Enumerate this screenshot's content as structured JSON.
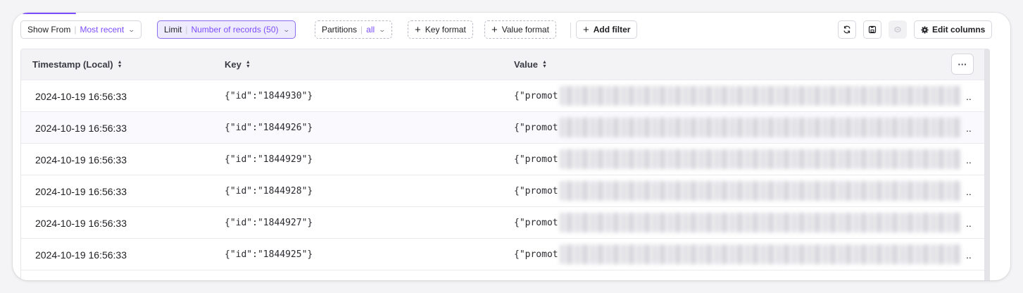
{
  "toolbar": {
    "show_from": {
      "label": "Show From",
      "value": "Most recent"
    },
    "limit": {
      "label": "Limit",
      "value": "Number of records (50)"
    },
    "partitions": {
      "label": "Partitions",
      "value": "all"
    },
    "key_format": "Key format",
    "value_format": "Value format",
    "add_filter": "Add filter",
    "edit_columns": "Edit columns",
    "accent_color": "#7c4dff"
  },
  "table": {
    "columns": [
      "Timestamp (Local)",
      "Key",
      "Value"
    ],
    "more_label": "···",
    "rows": [
      {
        "timestamp": "2024-10-19 16:56:33",
        "key": "{\"id\":\"1844930\"}",
        "value": "{\"promot",
        "ellipsis": ".."
      },
      {
        "timestamp": "2024-10-19 16:56:33",
        "key": "{\"id\":\"1844926\"}",
        "value": "{\"promot",
        "ellipsis": ".."
      },
      {
        "timestamp": "2024-10-19 16:56:33",
        "key": "{\"id\":\"1844929\"}",
        "value": "{\"promot",
        "ellipsis": ".."
      },
      {
        "timestamp": "2024-10-19 16:56:33",
        "key": "{\"id\":\"1844928\"}",
        "value": "{\"promot",
        "ellipsis": ".."
      },
      {
        "timestamp": "2024-10-19 16:56:33",
        "key": "{\"id\":\"1844927\"}",
        "value": "{\"promot",
        "ellipsis": ".."
      },
      {
        "timestamp": "2024-10-19 16:56:33",
        "key": "{\"id\":\"1844925\"}",
        "value": "{\"promot",
        "ellipsis": ".."
      }
    ]
  }
}
